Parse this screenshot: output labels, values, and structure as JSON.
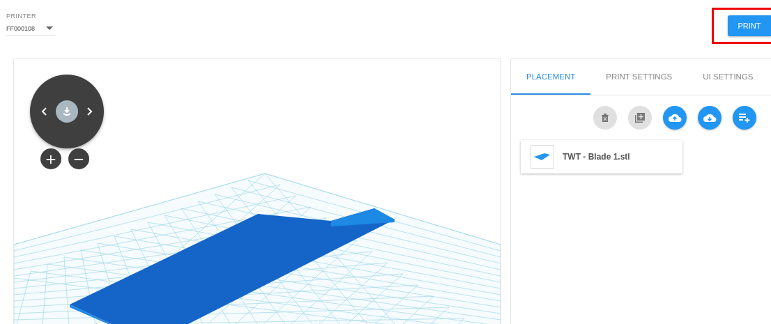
{
  "printer": {
    "label": "PRINTER",
    "value": "FF000108"
  },
  "print_button": {
    "label": "PRINT"
  },
  "viewport": {
    "zoom_in": "+",
    "zoom_out": "−"
  },
  "tabs": [
    {
      "label": "PLACEMENT",
      "selected": true
    },
    {
      "label": "PRINT SETTINGS",
      "selected": false
    },
    {
      "label": "UI SETTINGS",
      "selected": false
    }
  ],
  "toolbar": [
    {
      "kind": "delete",
      "disabled": true
    },
    {
      "kind": "duplicate",
      "disabled": true
    },
    {
      "kind": "upload",
      "disabled": false
    },
    {
      "kind": "download",
      "disabled": false
    },
    {
      "kind": "add-list",
      "disabled": false
    }
  ],
  "models": [
    {
      "name": "TWT - Blade 1.stl"
    }
  ]
}
